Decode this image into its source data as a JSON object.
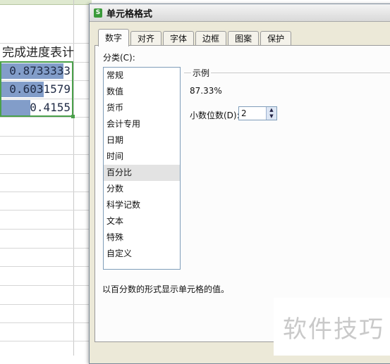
{
  "sheet": {
    "title": "完成进度表计",
    "rows": [
      {
        "value": "0.8733333",
        "progress": 0.8733
      },
      {
        "value": "0.6031579",
        "progress": 0.6032
      },
      {
        "value": "0.4155",
        "progress": 0.4155
      }
    ]
  },
  "dialog": {
    "icon_glyph": "S",
    "title": "单元格格式",
    "tabs": [
      "数字",
      "对齐",
      "字体",
      "边框",
      "图案",
      "保护"
    ],
    "active_tab": "数字",
    "category_label": "分类(C):",
    "categories": [
      "常规",
      "数值",
      "货币",
      "会计专用",
      "日期",
      "时间",
      "百分比",
      "分数",
      "科学记数",
      "文本",
      "特殊",
      "自定义"
    ],
    "selected_category": "百分比",
    "sample_label": "示例",
    "sample_value": "87.33%",
    "decimal_label": "小数位数(D):",
    "decimal_value": "2",
    "description": "以百分数的形式显示单元格的值。"
  },
  "watermark": "软件技巧",
  "colors": {
    "selection_border": "#4aa04a",
    "databar": "#6c8cc0",
    "dialog_bg": "#ece9d8"
  }
}
